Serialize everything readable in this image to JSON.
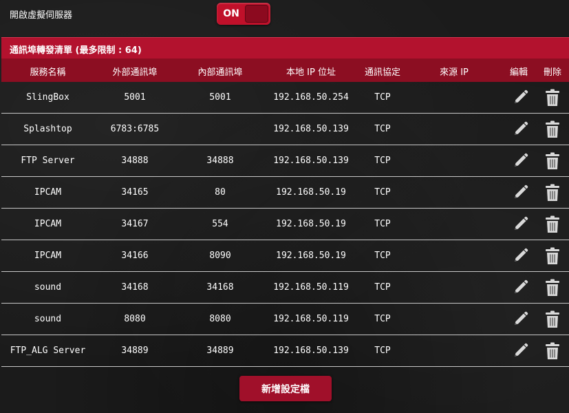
{
  "virtual_server": {
    "label": "開啟虛擬伺服器",
    "toggle_value": "ON"
  },
  "list": {
    "title": "通訊埠轉發清單 (最多限制 :",
    "limit": "64)"
  },
  "columns": {
    "service_name": "服務名稱",
    "external_port": "外部通訊埠",
    "internal_port": "內部通訊埠",
    "local_ip": "本地 IP 位址",
    "protocol": "通訊協定",
    "source_ip": "來源 IP",
    "edit": "編輯",
    "delete": "刪除"
  },
  "rows": [
    {
      "service_name": "SlingBox",
      "external_port": "5001",
      "internal_port": "5001",
      "local_ip": "192.168.50.254",
      "protocol": "TCP",
      "source_ip": ""
    },
    {
      "service_name": "Splashtop",
      "external_port": "6783:6785",
      "internal_port": "",
      "local_ip": "192.168.50.139",
      "protocol": "TCP",
      "source_ip": ""
    },
    {
      "service_name": "FTP Server",
      "external_port": "34888",
      "internal_port": "34888",
      "local_ip": "192.168.50.139",
      "protocol": "TCP",
      "source_ip": ""
    },
    {
      "service_name": "IPCAM",
      "external_port": "34165",
      "internal_port": "80",
      "local_ip": "192.168.50.19",
      "protocol": "TCP",
      "source_ip": ""
    },
    {
      "service_name": "IPCAM",
      "external_port": "34167",
      "internal_port": "554",
      "local_ip": "192.168.50.19",
      "protocol": "TCP",
      "source_ip": ""
    },
    {
      "service_name": "IPCAM",
      "external_port": "34166",
      "internal_port": "8090",
      "local_ip": "192.168.50.19",
      "protocol": "TCP",
      "source_ip": ""
    },
    {
      "service_name": "sound",
      "external_port": "34168",
      "internal_port": "34168",
      "local_ip": "192.168.50.119",
      "protocol": "TCP",
      "source_ip": ""
    },
    {
      "service_name": "sound",
      "external_port": "8080",
      "internal_port": "8080",
      "local_ip": "192.168.50.119",
      "protocol": "TCP",
      "source_ip": ""
    },
    {
      "service_name": "FTP_ALG Server",
      "external_port": "34889",
      "internal_port": "34889",
      "local_ip": "192.168.50.139",
      "protocol": "TCP",
      "source_ip": ""
    }
  ],
  "row_icons": {
    "edit": "pencil-icon",
    "delete": "trash-icon"
  },
  "add_button_label": "新增設定檔",
  "colors": {
    "accent": "#b3122e",
    "header_dark": "#8c0e22",
    "background": "#1b1b1b",
    "icon": "#d9d9d9"
  }
}
